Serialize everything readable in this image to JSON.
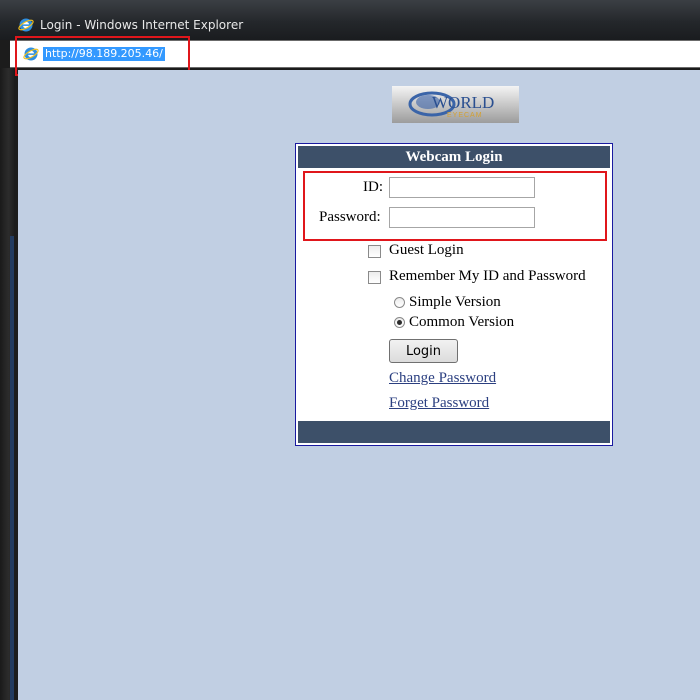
{
  "window": {
    "title": "Login - Windows Internet Explorer",
    "icon": "ie-icon"
  },
  "address_bar": {
    "url": "http://98.189.205.46/"
  },
  "logo": {
    "text_main": "WORLD",
    "text_sub": "EYECAM"
  },
  "login_panel": {
    "header": "Webcam Login",
    "id_label": "ID:",
    "id_value": "",
    "password_label": "Password:",
    "password_value": "",
    "guest_login_label": "Guest Login",
    "guest_login_checked": false,
    "remember_label": "Remember My ID and Password",
    "remember_checked": false,
    "version_options": [
      {
        "label": "Simple Version",
        "selected": false
      },
      {
        "label": "Common Version",
        "selected": true
      }
    ],
    "login_button": "Login",
    "change_password_link": "Change Password",
    "forget_password_link": "Forget Password"
  },
  "colors": {
    "page_background": "#c1cfe3",
    "panel_header": "#3d5069",
    "highlight_box": "#e0161b",
    "link": "#2b3f80"
  }
}
